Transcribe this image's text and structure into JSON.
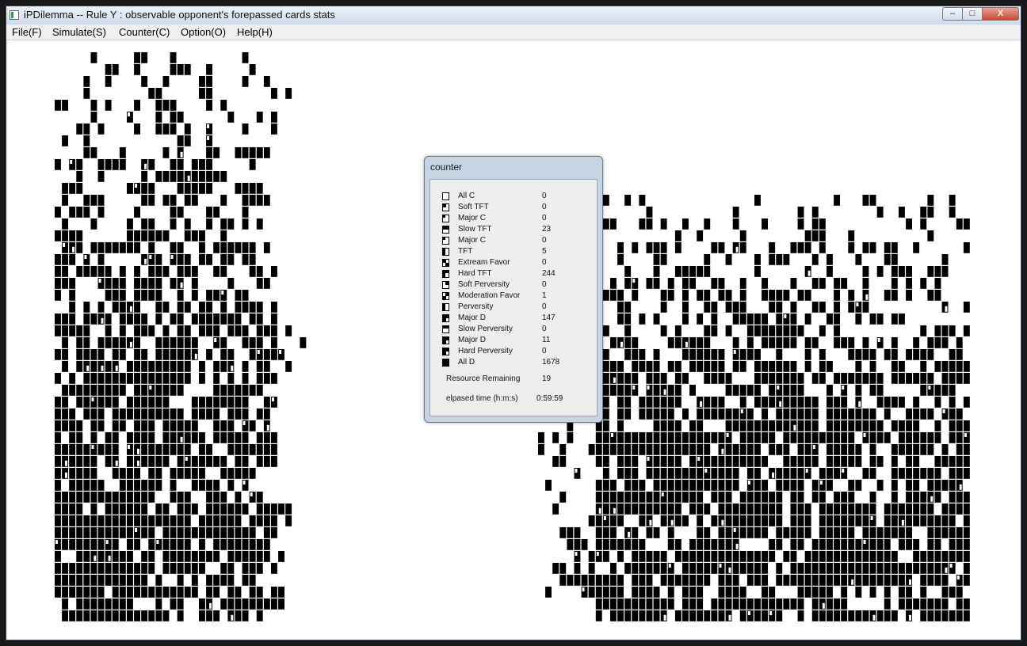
{
  "window": {
    "title": "iPDilemma -- Rule Y : observable opponent's forepassed cards stats",
    "minimize_label": "–",
    "maximize_label": "□",
    "close_label": "X"
  },
  "menu": [
    {
      "label": "File(F)"
    },
    {
      "label": "Simulate(S)"
    },
    {
      "label": "Counter(C)"
    },
    {
      "label": "Option(O)"
    },
    {
      "label": "Help(H)"
    }
  ],
  "counter_dialog": {
    "title": "counter",
    "rows": [
      {
        "label": "All C",
        "value": "0",
        "icon": "all-c-icon"
      },
      {
        "label": "Soft TFT",
        "value": "0",
        "icon": "soft-tft-icon"
      },
      {
        "label": "Major C",
        "value": "0",
        "icon": "major-c-icon"
      },
      {
        "label": "Slow TFT",
        "value": "23",
        "icon": "slow-tft-icon"
      },
      {
        "label": "Major C",
        "value": "0",
        "icon": "major-c-icon"
      },
      {
        "label": "TFT",
        "value": "5",
        "icon": "tft-icon"
      },
      {
        "label": "Extream Favor",
        "value": "0",
        "icon": "extream-favor-icon"
      },
      {
        "label": "Hard TFT",
        "value": "244",
        "icon": "hard-tft-icon"
      },
      {
        "label": "Soft Perversity",
        "value": "0",
        "icon": "soft-perversity-icon"
      },
      {
        "label": "Moderation Favor",
        "value": "1",
        "icon": "moderation-favor-icon"
      },
      {
        "label": "Perversity",
        "value": "0",
        "icon": "perversity-icon"
      },
      {
        "label": "Major D",
        "value": "147",
        "icon": "major-d-icon"
      },
      {
        "label": "Slow Perversity",
        "value": "0",
        "icon": "slow-perversity-icon"
      },
      {
        "label": "Major D",
        "value": "11",
        "icon": "major-d-icon"
      },
      {
        "label": "Hard Perversity",
        "value": "0",
        "icon": "hard-perversity-icon"
      },
      {
        "label": "All D",
        "value": "1678",
        "icon": "all-d-icon"
      }
    ],
    "resource_label": "Resource Remaining",
    "resource_value": "19",
    "elapsed_label": "elpased time (h:m:s)",
    "elapsed_value": "0:59:59"
  },
  "colors": {
    "cell_black": "#000000",
    "cell_white": "#ffffff",
    "canvas": "#ffffff",
    "titlebar": "#cfdbe9"
  },
  "grid_legend": "black cells = All D strategy; patterned cells = TFT variants"
}
